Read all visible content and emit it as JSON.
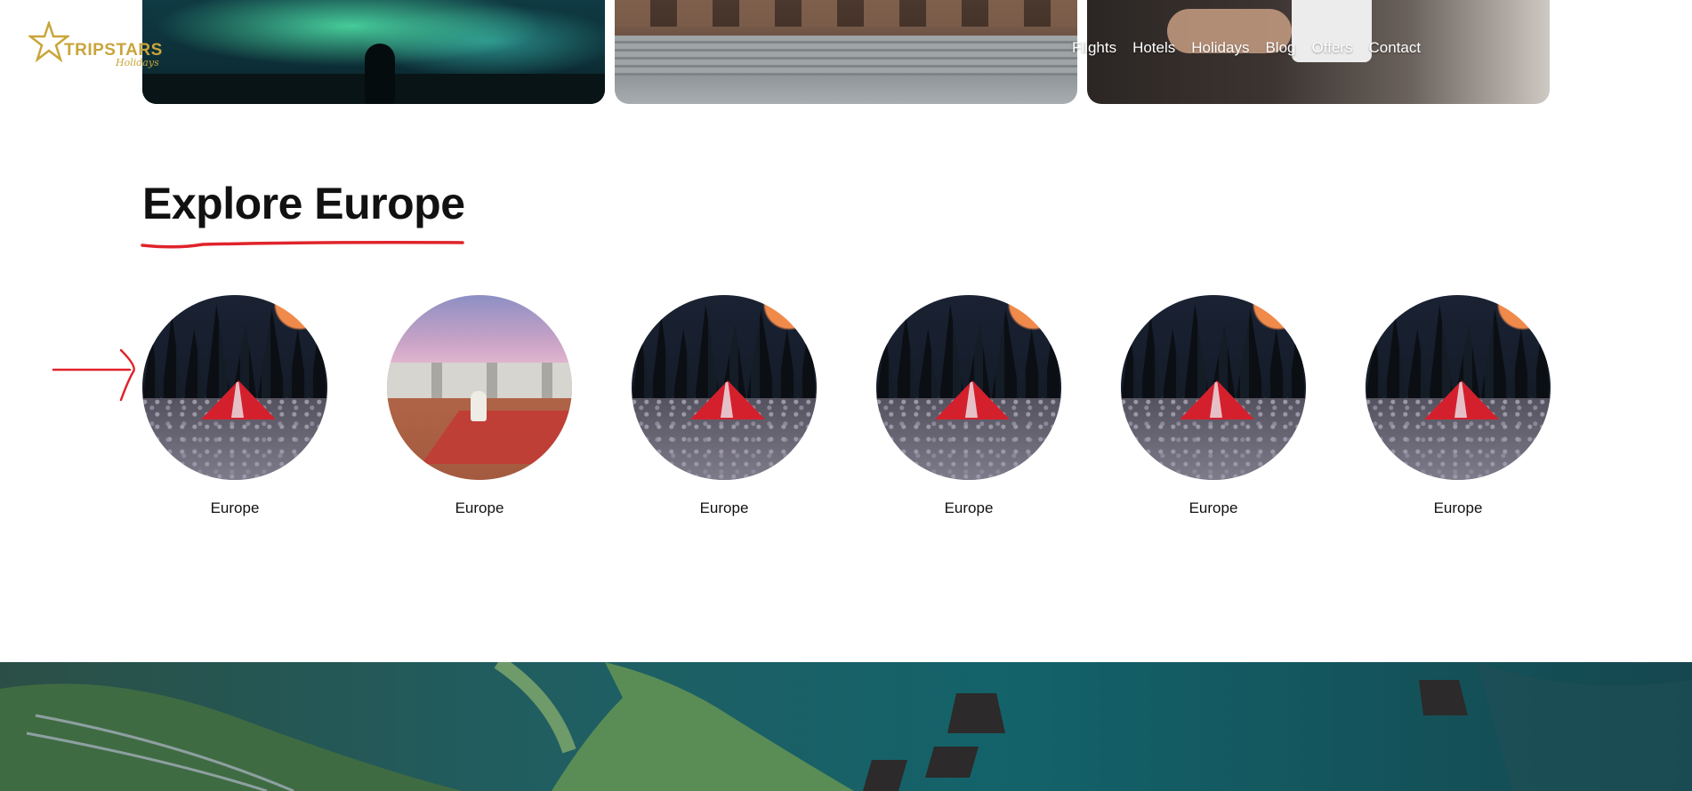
{
  "brand": {
    "name": "TRIPSTARS",
    "tagline": "Holidays",
    "color": "#c9a53a"
  },
  "nav": [
    "Flights",
    "Hotels",
    "Holidays",
    "Blog",
    "Offers",
    "Contact"
  ],
  "section": {
    "title": "Explore Europe",
    "accent_color": "#e0232b"
  },
  "destinations": [
    {
      "label": "Europe",
      "image": "tent-at-night"
    },
    {
      "label": "Europe",
      "image": "desert-camp"
    },
    {
      "label": "Europe",
      "image": "tent-at-night"
    },
    {
      "label": "Europe",
      "image": "tent-at-night"
    },
    {
      "label": "Europe",
      "image": "tent-at-night"
    },
    {
      "label": "Europe",
      "image": "tent-at-night"
    }
  ]
}
